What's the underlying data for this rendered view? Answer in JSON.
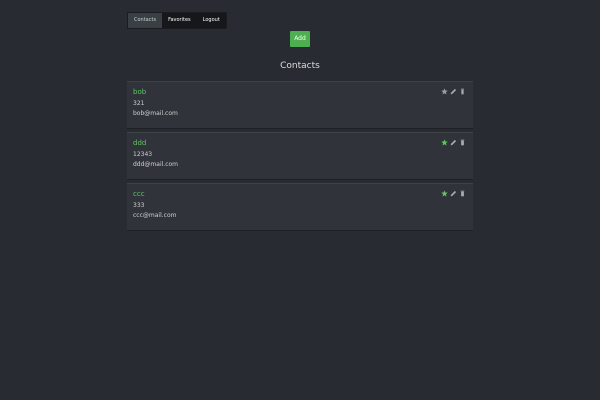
{
  "nav": {
    "items": [
      {
        "label": "Contacts",
        "active": true
      },
      {
        "label": "Favorites",
        "active": false
      },
      {
        "label": "Logout",
        "active": false
      }
    ]
  },
  "add_button": {
    "label": "Add"
  },
  "heading": "Contacts",
  "contacts": [
    {
      "name": "bob",
      "phone": "321",
      "email": "bob@mail.com",
      "favorite": false
    },
    {
      "name": "ddd",
      "phone": "12343",
      "email": "ddd@mail.com",
      "favorite": true
    },
    {
      "name": "ccc",
      "phone": "333",
      "email": "ccc@mail.com",
      "favorite": true
    }
  ],
  "colors": {
    "favorite_on": "#5fc35f",
    "favorite_off": "#9a9ea5",
    "accent": "#4caf50"
  },
  "icons": {
    "favorite": "star-icon",
    "edit": "pencil-icon",
    "delete": "trash-icon"
  }
}
